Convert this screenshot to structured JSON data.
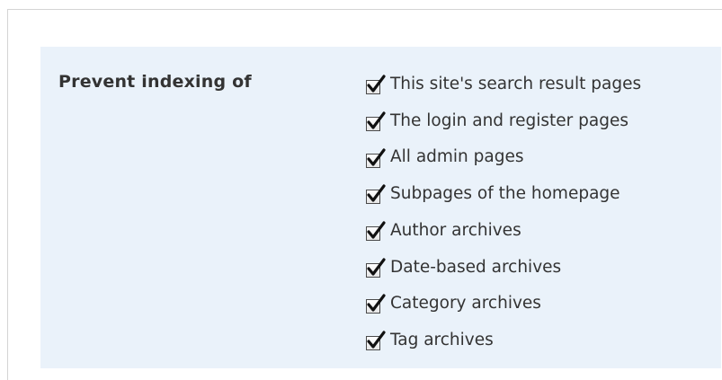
{
  "section": {
    "label": "Prevent indexing of"
  },
  "checkbox_state_color": "#111111",
  "options": [
    {
      "label": "This site's search result pages",
      "checked": true
    },
    {
      "label": "The login and register pages",
      "checked": true
    },
    {
      "label": "All admin pages",
      "checked": true
    },
    {
      "label": "Subpages of the homepage",
      "checked": true
    },
    {
      "label": "Author archives",
      "checked": true
    },
    {
      "label": "Date-based archives",
      "checked": true
    },
    {
      "label": "Category archives",
      "checked": true
    },
    {
      "label": "Tag archives",
      "checked": true
    }
  ]
}
